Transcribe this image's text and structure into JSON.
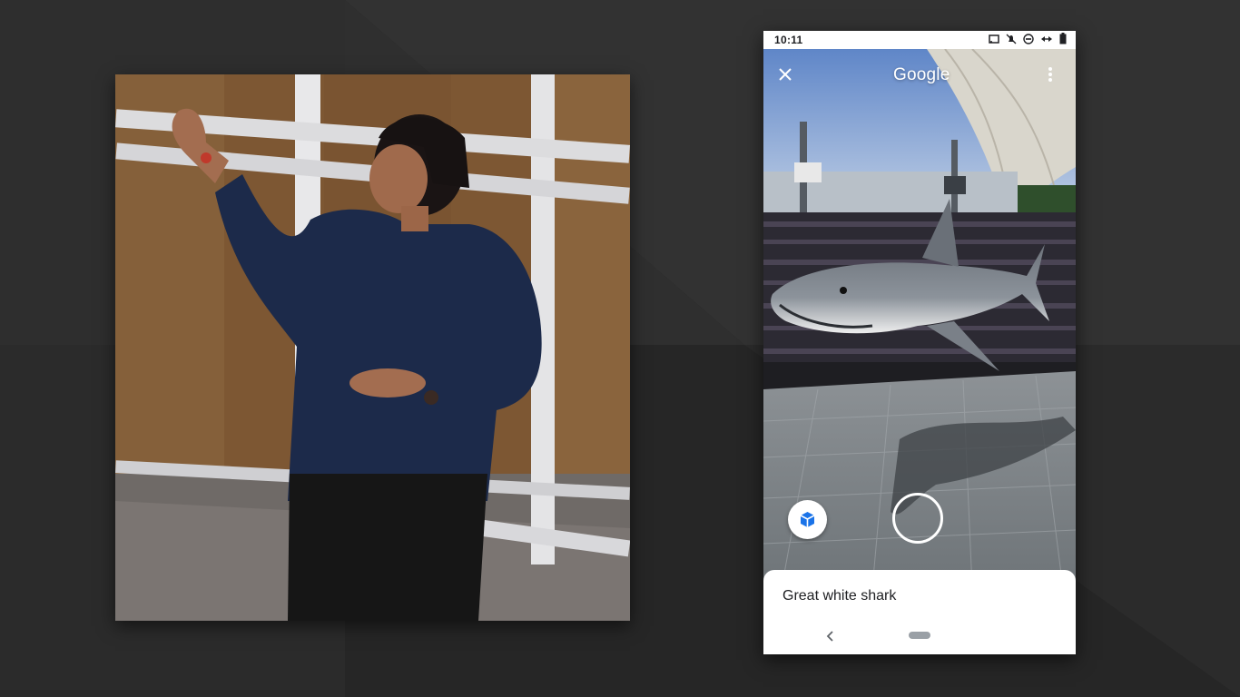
{
  "stage": {
    "panel": "stage-camera-feed"
  },
  "phone": {
    "status_bar": {
      "time": "10:11",
      "icons": [
        "cast-icon",
        "notifications-off-icon",
        "do-not-disturb-icon",
        "data-saver-icon",
        "battery-icon"
      ]
    },
    "top_bar": {
      "logo_text": "Google",
      "close_icon": "close-icon",
      "menu_icon": "more-vert-icon"
    },
    "camera": {
      "ar_object": "Great white shark",
      "ar_button_icon": "3d-cube-icon",
      "shutter_icon": "shutter-ring-icon"
    },
    "bottom_sheet": {
      "title": "Great white shark"
    },
    "nav_bar": {
      "back_icon": "back-chevron-icon",
      "home_icon": "home-pill-icon"
    }
  },
  "colors": {
    "background": "#2a2a2a",
    "sheet": "#ffffff",
    "text_primary": "#202124",
    "nav_pill": "#9aa0a6"
  }
}
